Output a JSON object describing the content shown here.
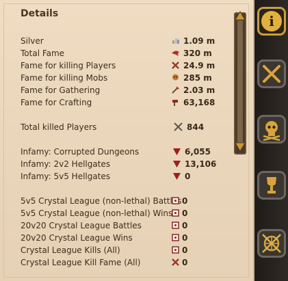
{
  "panel": {
    "title": "Details"
  },
  "stats": [
    {
      "label": "Silver",
      "icon": "silver-coin-icon",
      "value": "1.09 m"
    },
    {
      "label": "Total Fame",
      "icon": "fame-icon",
      "value": "320 m"
    },
    {
      "label": "Fame for killing Players",
      "icon": "pvp-fame-icon",
      "value": "24.9 m"
    },
    {
      "label": "Fame for killing Mobs",
      "icon": "pve-fame-icon",
      "value": "285 m"
    },
    {
      "label": "Fame for Gathering",
      "icon": "gathering-fame-icon",
      "value": "2.03 m"
    },
    {
      "label": "Fame for Crafting",
      "icon": "crafting-fame-icon",
      "value": "63,168"
    },
    {
      "label": "Total killed Players",
      "icon": "crossed-swords-icon",
      "value": "844"
    },
    {
      "label": "Infamy: Corrupted Dungeons",
      "icon": "infamy-icon",
      "value": "6,055"
    },
    {
      "label": "Infamy: 2v2 Hellgates",
      "icon": "infamy-icon",
      "value": "13,106"
    },
    {
      "label": "Infamy: 5v5 Hellgates",
      "icon": "infamy-icon",
      "value": "0"
    },
    {
      "label": "5v5 Crystal League (non-lethal) Battles",
      "icon": "crystal-league-icon",
      "value": "0"
    },
    {
      "label": "5v5 Crystal League (non-lethal) Wins",
      "icon": "crystal-league-icon",
      "value": "0"
    },
    {
      "label": "20v20 Crystal League Battles",
      "icon": "crystal-league-icon",
      "value": "0"
    },
    {
      "label": "20v20 Crystal League Wins",
      "icon": "crystal-league-icon",
      "value": "0"
    },
    {
      "label": "Crystal League Kills (All)",
      "icon": "crystal-league-icon",
      "value": "0"
    },
    {
      "label": "Crystal League Kill Fame (All)",
      "icon": "crystal-fame-icon",
      "value": "0"
    }
  ],
  "tabs": [
    {
      "name": "info",
      "glyph": "i"
    },
    {
      "name": "pvp",
      "glyph": "⚔"
    },
    {
      "name": "pve",
      "glyph": "☠"
    },
    {
      "name": "achievements",
      "glyph": "🏆"
    },
    {
      "name": "crystal-league",
      "glyph": "⚔"
    }
  ],
  "colors": {
    "panel_bg": "#ecd8bd",
    "text": "#3f2c1c",
    "accent": "#c9a040",
    "fame_red": "#b03024"
  }
}
